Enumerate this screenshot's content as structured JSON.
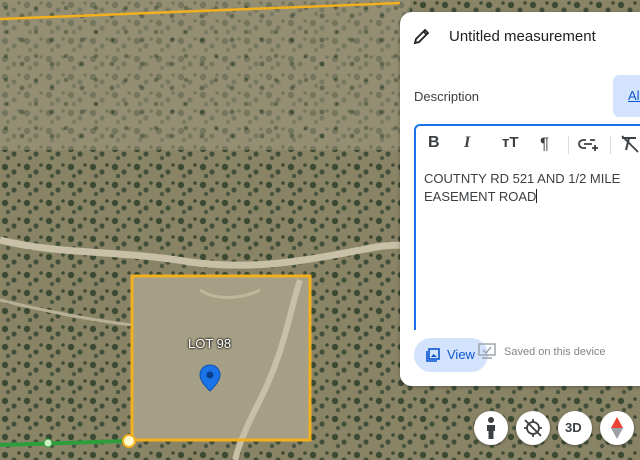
{
  "map": {
    "lot_label": "LOT 98",
    "marker_icon": "location-pin-icon",
    "lot_outline_color": "#f2b01e",
    "path_color": "#2e9d3c"
  },
  "panel": {
    "title": "Untitled measurement",
    "title_icon": "pencil-icon",
    "description_label": "Description",
    "all_button_label": "All",
    "description_text": "COUTNTY RD 521 AND 1/2 MILE EASEMENT ROAD",
    "toolbar": [
      "bold-icon",
      "italic-icon",
      "text-size-icon",
      "paragraph-icon",
      "add-link-icon",
      "clear-format-icon"
    ],
    "view_button_label": "View",
    "saved_status": "Saved on this device"
  },
  "controls": {
    "pegman_icon": "pegman-icon",
    "tilt_icon": "tilt-icon",
    "threed_label": "3D",
    "compass_icon": "compass-icon"
  }
}
